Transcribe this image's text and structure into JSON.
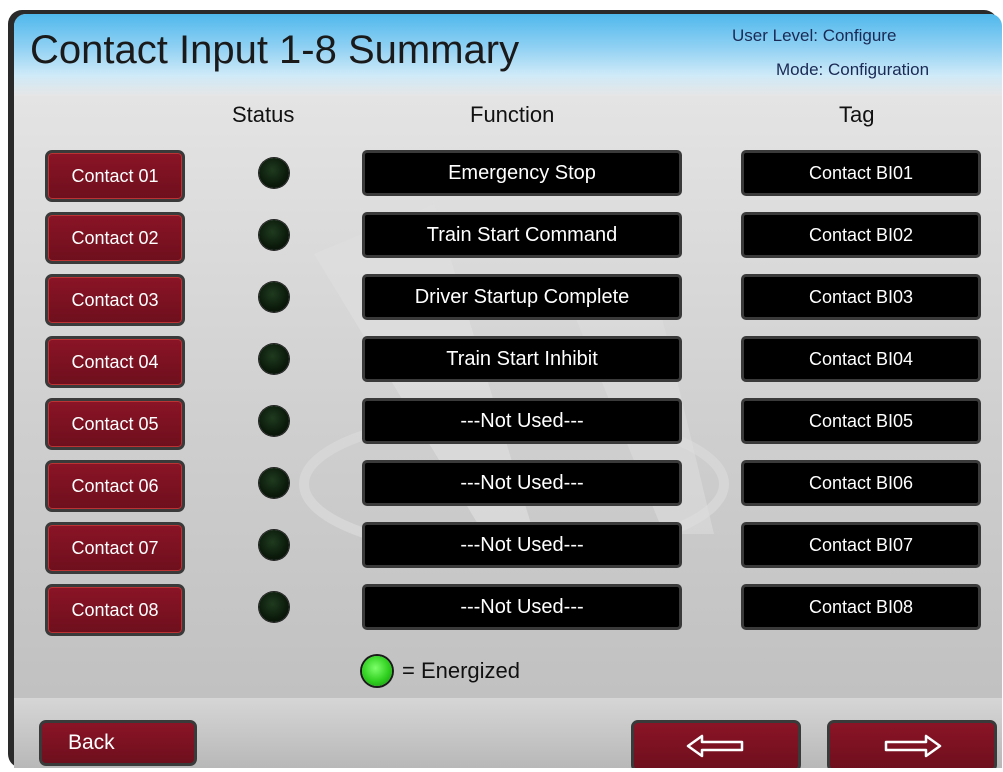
{
  "header": {
    "title": "Contact Input 1-8 Summary",
    "user_level": "User Level: Configure",
    "mode": "Mode: Configuration"
  },
  "columns": {
    "status": "Status",
    "function": "Function",
    "tag": "Tag"
  },
  "rows": [
    {
      "button": "Contact 01",
      "function": "Emergency Stop",
      "tag": "Contact BI01",
      "energized": false
    },
    {
      "button": "Contact 02",
      "function": "Train Start Command",
      "tag": "Contact BI02",
      "energized": false
    },
    {
      "button": "Contact 03",
      "function": "Driver Startup Complete",
      "tag": "Contact BI03",
      "energized": false
    },
    {
      "button": "Contact 04",
      "function": "Train Start Inhibit",
      "tag": "Contact BI04",
      "energized": false
    },
    {
      "button": "Contact 05",
      "function": "---Not Used---",
      "tag": "Contact BI05",
      "energized": false
    },
    {
      "button": "Contact 06",
      "function": "---Not Used---",
      "tag": "Contact BI06",
      "energized": false
    },
    {
      "button": "Contact 07",
      "function": "---Not Used---",
      "tag": "Contact BI07",
      "energized": false
    },
    {
      "button": "Contact 08",
      "function": "---Not Used---",
      "tag": "Contact BI08",
      "energized": false
    }
  ],
  "legend": {
    "text": "= Energized",
    "led_color": "#2fcf1f"
  },
  "nav": {
    "back_label": "Back",
    "prev_icon": "left-arrow-icon",
    "next_icon": "right-arrow-icon"
  },
  "colors": {
    "accent_button": "#7a1020",
    "title_bar": "#4fb8ec",
    "field_bg": "#000000",
    "led_off": "#0b1a0b"
  }
}
